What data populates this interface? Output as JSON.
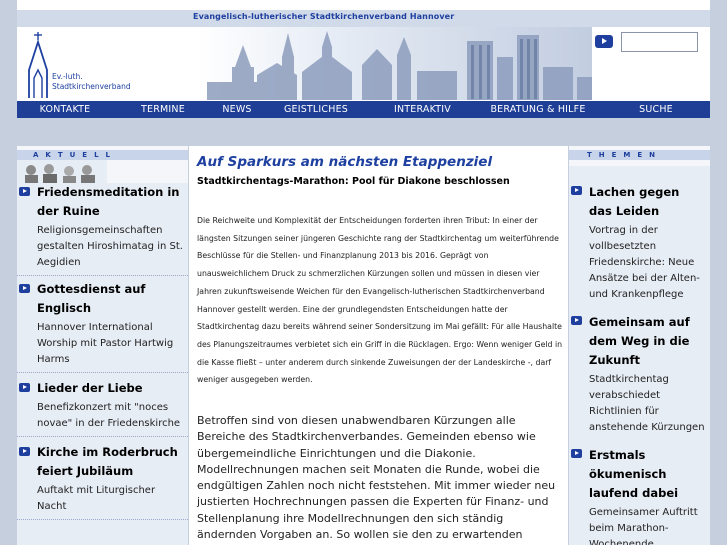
{
  "header": {
    "org_title": "Evangelisch-lutherischer Stadtkirchenverband Hannover",
    "logo_line1": "Ev.-luth.",
    "logo_line2": "Stadtkirchenverband"
  },
  "search": {
    "value": ""
  },
  "nav": [
    "KONTAKTE",
    "TERMINE",
    "NEWS",
    "GEISTLICHES",
    "INTERAKTIV",
    "BERATUNG & HILFE",
    "SUCHE"
  ],
  "aktuell": {
    "label": "AKTUELL",
    "items": [
      {
        "title": "Friedensmeditation in der Ruine",
        "text": "Religionsgemeinschaften gestalten Hiroshimatag in St. Aegidien"
      },
      {
        "title": "Gottesdienst auf Englisch",
        "text": "Hannover International Worship mit Pastor Hartwig Harms"
      },
      {
        "title": "Lieder der Liebe",
        "text": "Benefizkonzert mit \"noces novae\" in der Friedenskirche"
      },
      {
        "title": "Kirche im Roderbruch feiert Jubiläum",
        "text": "Auftakt mit Liturgischer Nacht"
      }
    ]
  },
  "article": {
    "headline": "Auf Sparkurs am nächsten Etappenziel",
    "subheadline": "Stadtkirchentags-Marathon: Pool für Diakone beschlossen",
    "lead": "Die Reichweite und Komplexität der Entscheidungen forderten ihren Tribut: In einer der längsten Sitzungen seiner jüngeren Geschichte rang der Stadtkirchentag um weiterführende Beschlüsse für die Stellen- und Finanzplanung 2013 bis 2016. Geprägt von unausweichlichem Druck zu schmerzlichen Kürzungen sollen und müssen in diesen vier Jahren zukunftsweisende Weichen für den Evangelisch-lutherischen Stadtkirchenverband Hannover gestellt werden. Eine der grundlegendsten Entscheidungen hatte der Stadtkirchentag dazu bereits während seiner Sondersitzung im Mai gefällt: Für alle Haushalte des Planungszeitraumes verbietet sich ein Griff in die Rücklagen. Ergo: Wenn weniger Geld in die Kasse fließt – unter anderem durch sinkende Zuweisungen der der Landeskirche -, darf weniger ausgegeben werden.",
    "body": "Betroffen sind von diesen unabwendbaren Kürzungen alle Bereiche des Stadtkirchenverbandes. Gemeinden ebenso wie übergemeindliche Einrichtungen und die Diakonie. Modellrechnungen machen seit Monaten die Runde, wobei die endgültigen Zahlen noch nicht feststehen. Mit immer wieder neu justierten Hochrechnungen passen die Experten für Finanz- und Stellenplanung ihre Modellrechnungen den sich ständig ändernden Vorgaben an. So wollen sie den zu erwartenden Zahlen möglichst nahe zu kommen,"
  },
  "themen": {
    "label": "THEMEN",
    "items": [
      {
        "title": "Lachen gegen das Leiden",
        "text": "Vortrag in der vollbesetzten Friedenskirche: Neue Ansätze bei der Alten- und Krankenpflege"
      },
      {
        "title": "Gemeinsam auf dem Weg in die Zukunft",
        "text": "Stadtkirchentag verabschiedet Richtlinien für anstehende Kürzungen"
      },
      {
        "title": "Erstmals ökumenisch laufend dabei",
        "text": "Gemeinsamer Auftritt beim Marathon-Wochenende"
      }
    ]
  },
  "colors": {
    "brand_blue": "#1f3f96",
    "page_bg": "#c6cfdd",
    "sidebar_bg": "#e7edf5",
    "headline_blue": "#1e40a0"
  }
}
